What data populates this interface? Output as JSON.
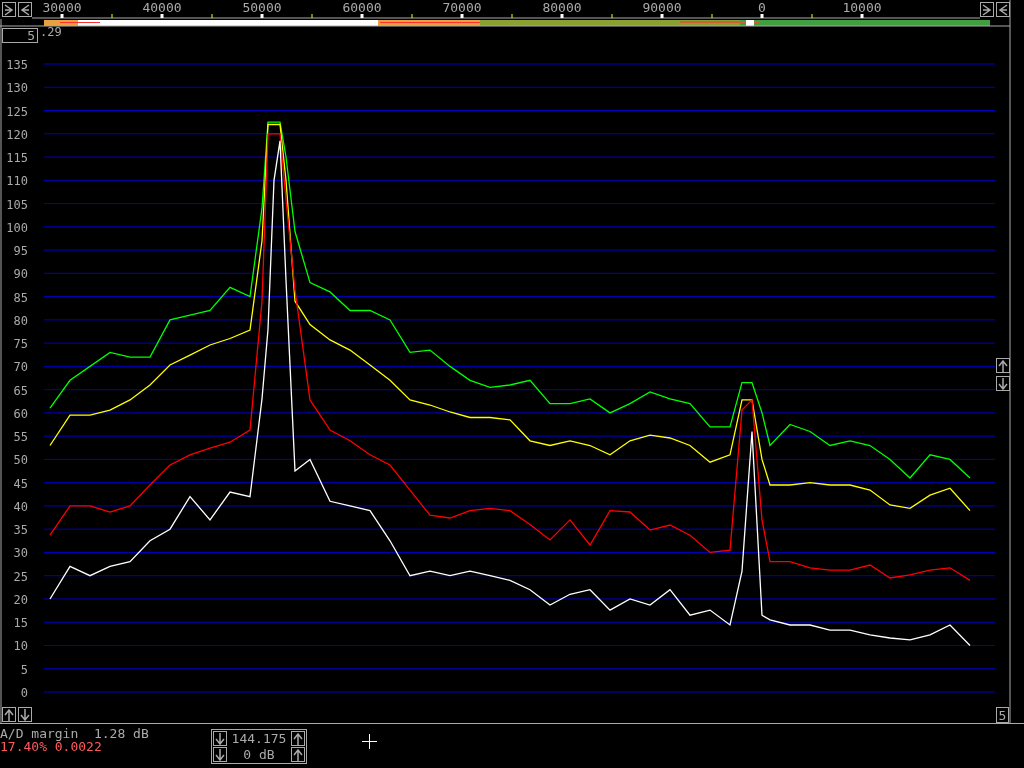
{
  "overlay_label": ".29",
  "gain_box": "5",
  "chart": {
    "chart_data": {
      "type": "line",
      "x": [
        28800,
        30800,
        32800,
        34800,
        36800,
        38800,
        40800,
        42800,
        44800,
        46800,
        48800,
        50000,
        50600,
        51200,
        51800,
        52400,
        53300,
        54800,
        56800,
        58800,
        60800,
        62800,
        64800,
        66800,
        68800,
        70800,
        72800,
        74800,
        76800,
        78800,
        80800,
        82800,
        84800,
        86800,
        88800,
        90800,
        92800,
        94800,
        96800,
        98000,
        99000,
        100000,
        100800,
        102800,
        104800,
        106800,
        108800,
        110800,
        112800,
        114800,
        116800,
        118800,
        120800
      ],
      "series": [
        {
          "color": "#00ff00",
          "values": [
            61,
            67,
            70,
            73,
            72,
            72,
            80,
            81,
            82,
            87,
            85,
            104,
            122.5,
            122.5,
            122.5,
            115,
            99,
            88,
            86,
            82,
            82,
            80,
            73,
            73.5,
            70,
            67,
            65.5,
            66,
            67,
            62,
            62,
            63,
            60,
            62,
            64.5,
            63,
            62,
            57,
            57,
            66.5,
            66.5,
            60,
            53,
            57.5,
            56,
            53,
            54,
            53,
            50,
            46,
            51,
            50,
            46
          ]
        },
        {
          "color": "#ffff00",
          "values": [
            53,
            59.5,
            59.5,
            60.6,
            62.8,
            66,
            70.3,
            72.4,
            74.6,
            76,
            77.8,
            97,
            122,
            122,
            122,
            110,
            84,
            79,
            75.7,
            73.5,
            70.3,
            67,
            62.8,
            61.7,
            60.2,
            59,
            59,
            58.5,
            54,
            53,
            54,
            53,
            51,
            54,
            55.2,
            54.6,
            53,
            49.4,
            51,
            62.8,
            62.8,
            50,
            44.5,
            44.5,
            45,
            44.5,
            44.5,
            43.4,
            40.2,
            39.5,
            42.3,
            43.8,
            39
          ]
        },
        {
          "color": "#ff0000",
          "values": [
            33.7,
            40,
            40,
            38.7,
            40,
            44.5,
            48.8,
            51,
            52.4,
            53.7,
            56.3,
            84,
            120,
            120,
            120,
            105.8,
            86.4,
            62.8,
            56.3,
            54,
            51,
            48.8,
            43.4,
            38,
            37.4,
            39,
            39.5,
            39,
            36,
            32.7,
            37,
            31.6,
            39,
            38.7,
            34.8,
            35.9,
            33.7,
            30,
            30.5,
            60.6,
            62.8,
            37,
            28,
            28,
            26.7,
            26.2,
            26.2,
            27.3,
            24.5,
            25.2,
            26.2,
            26.7,
            24
          ]
        },
        {
          "color": "#ffffff",
          "values": [
            20,
            27,
            25,
            27,
            28,
            32.5,
            35,
            42,
            37,
            43,
            42,
            63,
            78,
            110,
            118.5,
            88.5,
            47.5,
            50,
            41,
            40,
            39,
            32.5,
            25,
            26,
            25,
            26,
            25,
            24,
            22,
            18.7,
            21,
            22,
            17.6,
            20,
            18.7,
            22,
            16.5,
            17.6,
            14.4,
            26,
            56,
            16.5,
            15.5,
            14.4,
            14.4,
            13.3,
            13.3,
            12.3,
            11.6,
            11.2,
            12.3,
            14.4,
            10
          ]
        }
      ],
      "xlim": [
        28200,
        122800
      ],
      "ylim": [
        0,
        135
      ],
      "grid": true,
      "xticks": [
        30000,
        40000,
        50000,
        60000,
        70000,
        80000,
        90000
      ],
      "yticks": [
        0,
        5,
        10,
        15,
        20,
        25,
        30,
        35,
        40,
        45,
        50,
        55,
        60,
        65,
        70,
        75,
        80,
        85,
        90,
        95,
        100,
        105,
        110,
        115,
        120,
        125,
        130,
        135
      ]
    }
  },
  "wrapped_scale_labels": [
    "0",
    "10000"
  ],
  "right_box": "5",
  "status": {
    "ad_margin": "A/D margin  1.28 dB",
    "overload": "17.40% 0.0022"
  },
  "tuning": {
    "frequency": "144.175",
    "gain": "0 dB"
  }
}
